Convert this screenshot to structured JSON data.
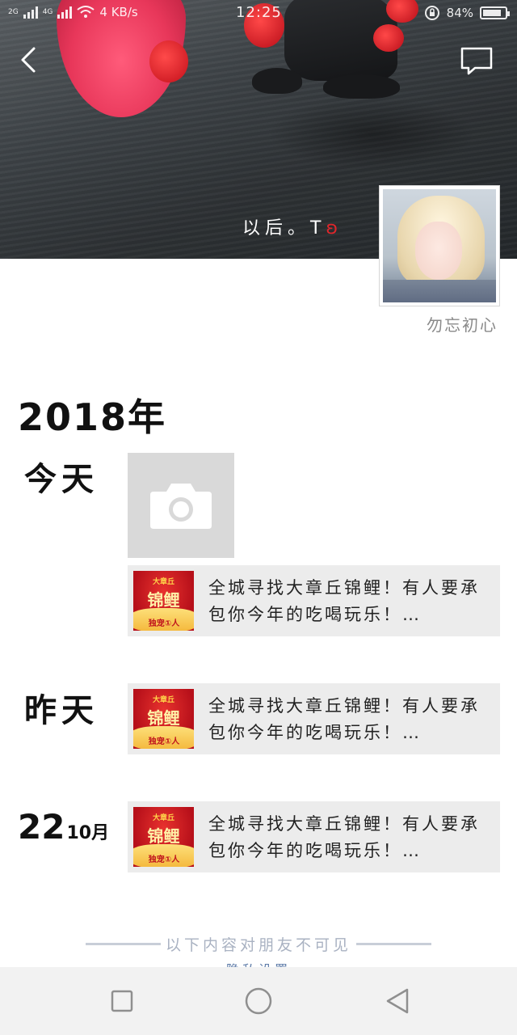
{
  "status_bar": {
    "network_1": "2G",
    "network_2": "4G",
    "speed": "4 KB/s",
    "time": "12:25",
    "battery_percent": "84%",
    "battery_level": 0.84
  },
  "cover": {
    "owner_name": "以后。T",
    "owner_name_suffix": "ʚ"
  },
  "profile": {
    "name": "勿忘初心"
  },
  "timeline": {
    "year": "2018年",
    "groups": [
      {
        "label": "今天"
      },
      {
        "label": "昨天"
      },
      {
        "day": "22",
        "month": "10月"
      }
    ],
    "shares": [
      {
        "text": "全城寻找大章丘锦鲤！有人要承包你今年的吃喝玩乐！…",
        "thumb_top": "大章丘",
        "thumb_mid": "锦鲤",
        "thumb_bottom": "独宠①人"
      },
      {
        "text": "全城寻找大章丘锦鲤！有人要承包你今年的吃喝玩乐！…",
        "thumb_top": "大章丘",
        "thumb_mid": "锦鲤",
        "thumb_bottom": "独宠①人"
      },
      {
        "text": "全城寻找大章丘锦鲤！有人要承包你今年的吃喝玩乐！…",
        "thumb_top": "大章丘",
        "thumb_mid": "锦鲤",
        "thumb_bottom": "独宠①人"
      }
    ]
  },
  "footer": {
    "hidden_note": "以下内容对朋友不可见",
    "privacy_link": "隐私设置"
  },
  "icons": {
    "back": "chevron-left-icon",
    "comment": "message-bubble-icon",
    "camera": "camera-icon",
    "nav_recent": "square-icon",
    "nav_home": "circle-icon",
    "nav_back": "triangle-back-icon"
  },
  "colors": {
    "accent_link": "#5d7ba8",
    "heart": "#e0262b",
    "card_bg": "#ececec"
  }
}
